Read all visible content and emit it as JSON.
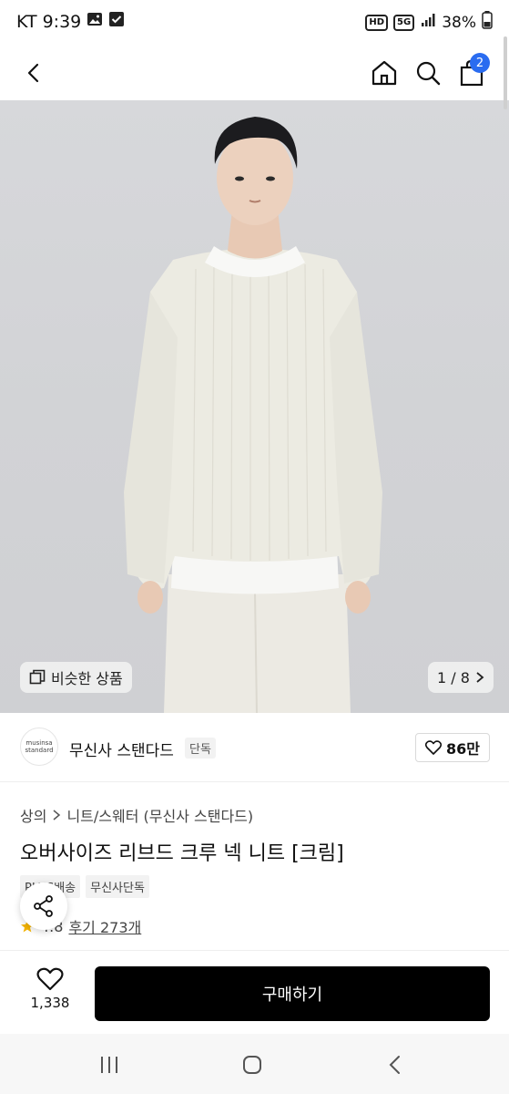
{
  "status_bar": {
    "carrier": "KT",
    "time": "9:39",
    "hd_label": "HD",
    "network_label": "5G",
    "battery": "38%"
  },
  "header": {
    "cart_count": "2"
  },
  "gallery": {
    "similar_label": "비슷한 상품",
    "page_indicator": "1 / 8"
  },
  "brand": {
    "logo_line1": "musinsa",
    "logo_line2": "standard",
    "name": "무신사 스탠다드",
    "badge": "단독",
    "likes": "86만"
  },
  "product": {
    "breadcrumb": [
      "상의",
      "니트/스웨터 (무신사 스탠다드)"
    ],
    "title": "오버사이즈 리브드 크루 넥 니트 [크림]",
    "tags": [
      "PLUS배송",
      "무신사단독"
    ],
    "rating": "4.8",
    "reviews": "후기 273개"
  },
  "bottom": {
    "wish_count": "1,338",
    "buy_label": "구매하기"
  },
  "colors": {
    "accent": "#2a6cf0",
    "buy_button": "#000000",
    "star": "#f5b400"
  }
}
